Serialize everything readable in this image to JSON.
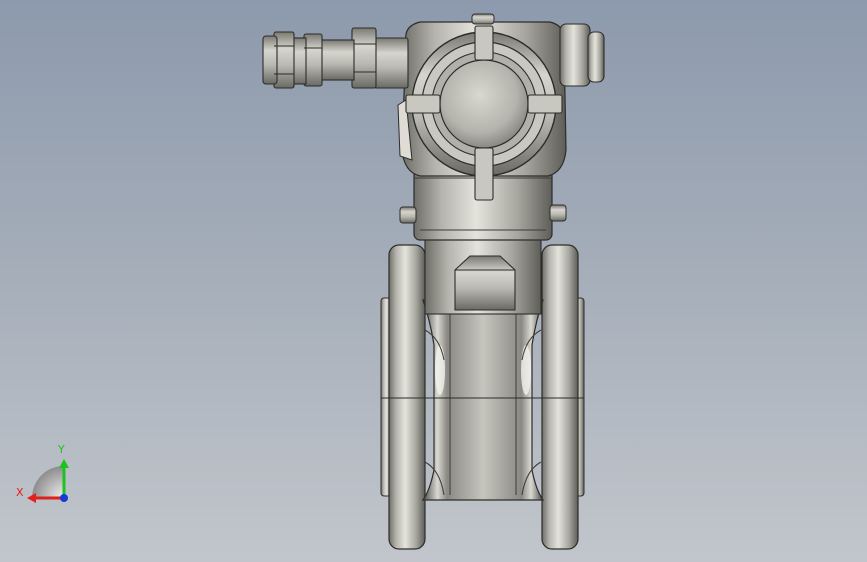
{
  "view": {
    "background_top": "#8d9aad",
    "background_bottom": "#c2c6cc",
    "model_color": "#b9b8b1"
  },
  "triad": {
    "x_label": "X",
    "y_label": "Y",
    "x_color": "#e0201a",
    "y_color": "#1ec21e",
    "z_color": "#1a3ad8"
  }
}
